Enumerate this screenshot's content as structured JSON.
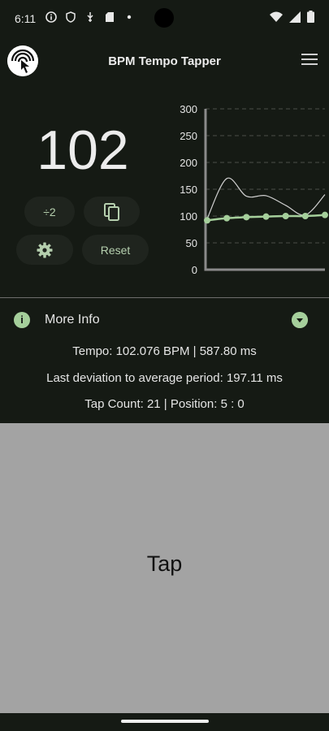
{
  "status_bar": {
    "time": "6:11",
    "icons": [
      "info-circle-icon",
      "shield-icon",
      "usb-icon",
      "sd-card-icon",
      "dot-icon"
    ],
    "right_icons": [
      "wifi-icon",
      "signal-icon",
      "battery-icon"
    ]
  },
  "app_bar": {
    "title": "BPM Tempo Tapper",
    "logo_icon": "tap-logo-icon",
    "menu_icon": "hamburger-menu-icon"
  },
  "tempo_display": {
    "bpm": "102"
  },
  "controls": {
    "halve_label": "÷2",
    "copy_icon": "copy-icon",
    "settings_icon": "gear-icon",
    "reset_label": "Reset"
  },
  "chart_data": {
    "type": "line",
    "ylim": [
      0,
      300
    ],
    "yticks": [
      "300",
      "250",
      "200",
      "150",
      "100",
      "50",
      "0"
    ],
    "grid": "dashed horizontal",
    "x": [
      1,
      2,
      3,
      4,
      5,
      6,
      7
    ],
    "series": [
      {
        "values": [
          92,
          96,
          98,
          99,
          100,
          100,
          102
        ]
      },
      {
        "values": [
          95,
          170,
          137,
          138,
          120,
          102,
          140
        ]
      }
    ],
    "colors": {
      "average": "#a5cf9b",
      "raw": "#cfcfcf",
      "axis": "#8a8a8a"
    }
  },
  "more_info": {
    "title": "More Info",
    "expand_icon": "chevron-down-circle-icon",
    "info_icon": "info-icon",
    "tempo_line": "Tempo: 102.076 BPM | 587.80 ms",
    "deviation_line": "Last deviation to average period: 197.11 ms",
    "tap_line": "Tap Count: 21 | Position: 5  : 0"
  },
  "tap_area": {
    "label": "Tap"
  },
  "colors": {
    "background": "#151a14",
    "accent": "#a5cf9b",
    "tap_area": "#a3a3a3"
  }
}
